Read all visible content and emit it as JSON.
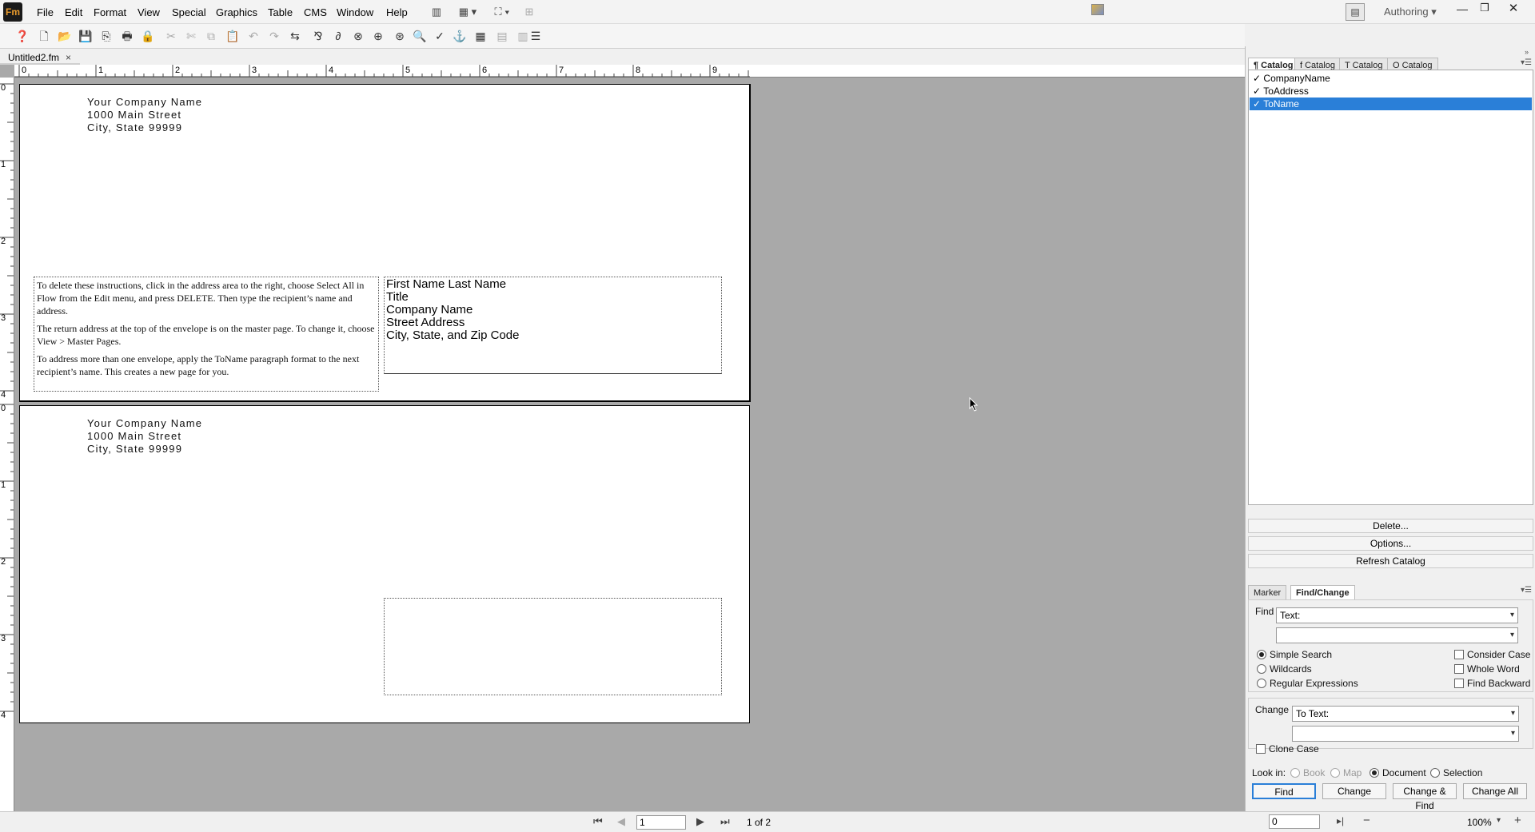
{
  "app": {
    "logo": "Fm",
    "mode": "Authoring"
  },
  "menu": [
    "File",
    "Edit",
    "Format",
    "View",
    "Special",
    "Graphics",
    "Table",
    "CMS",
    "Window",
    "Help"
  ],
  "document": {
    "tab_title": "Untitled2.fm",
    "close": "×"
  },
  "ruler_h": [
    "0",
    "1",
    "2",
    "3",
    "4",
    "5",
    "6",
    "7",
    "8",
    "9"
  ],
  "ruler_v1": [
    "0",
    "1",
    "2",
    "3",
    "4"
  ],
  "ruler_v2": [
    "0",
    "1",
    "2",
    "3",
    "4"
  ],
  "page1": {
    "return_address": [
      "Your Company Name",
      "1000 Main Street",
      "City, State 99999"
    ],
    "instructions": [
      "To delete these instructions, click in the address area to the right, choose Select All in Flow from the Edit menu, and press DELETE. Then type the recipient’s name and address.",
      "The return address at the top of the envelope is on the master page. To change it, choose View > Master Pages.",
      "To address more than one envelope, apply the ToName paragraph format to the next recipient’s name. This creates a new page for you."
    ],
    "recipient": [
      "First Name Last Name",
      "Title",
      "Company Name",
      "Street Address",
      "City, State, and Zip Code"
    ]
  },
  "page2": {
    "return_address": [
      "Your Company Name",
      "1000 Main Street",
      "City, State 99999"
    ]
  },
  "catalog": {
    "tabs": [
      "¶ Catalog",
      "f Catalog",
      "T Catalog",
      "O Catalog"
    ],
    "items": [
      "CompanyName",
      "ToAddress",
      "ToName"
    ],
    "selected": "ToName",
    "check": "✓",
    "buttons": {
      "delete": "Delete...",
      "options": "Options...",
      "refresh": "Refresh Catalog"
    }
  },
  "findchange": {
    "tabs": [
      "Marker",
      "Find/Change"
    ],
    "find_label": "Find",
    "find_type": "Text:",
    "find_value": "",
    "modes": [
      "Simple Search",
      "Wildcards",
      "Regular Expressions"
    ],
    "options": [
      "Consider Case",
      "Whole Word",
      "Find Backward"
    ],
    "change_label": "Change",
    "change_type": "To Text:",
    "change_value": "",
    "clone_case": "Clone Case",
    "look_in_label": "Look in:",
    "look_in": [
      "Book",
      "Map",
      "Document",
      "Selection"
    ],
    "look_in_selected": "Document",
    "buttons": {
      "find": "Find",
      "change": "Change",
      "change_find": "Change & Find",
      "change_all": "Change All"
    }
  },
  "status": {
    "page_input": "1",
    "page_count": "1 of 2",
    "right_input": "0",
    "zoom": "100%"
  },
  "colors": {
    "accent": "#2a7fd8",
    "doc_bg": "#a9a9a9",
    "logo_bg": "#1a1a1a",
    "logo_fg": "#e89a2c"
  }
}
